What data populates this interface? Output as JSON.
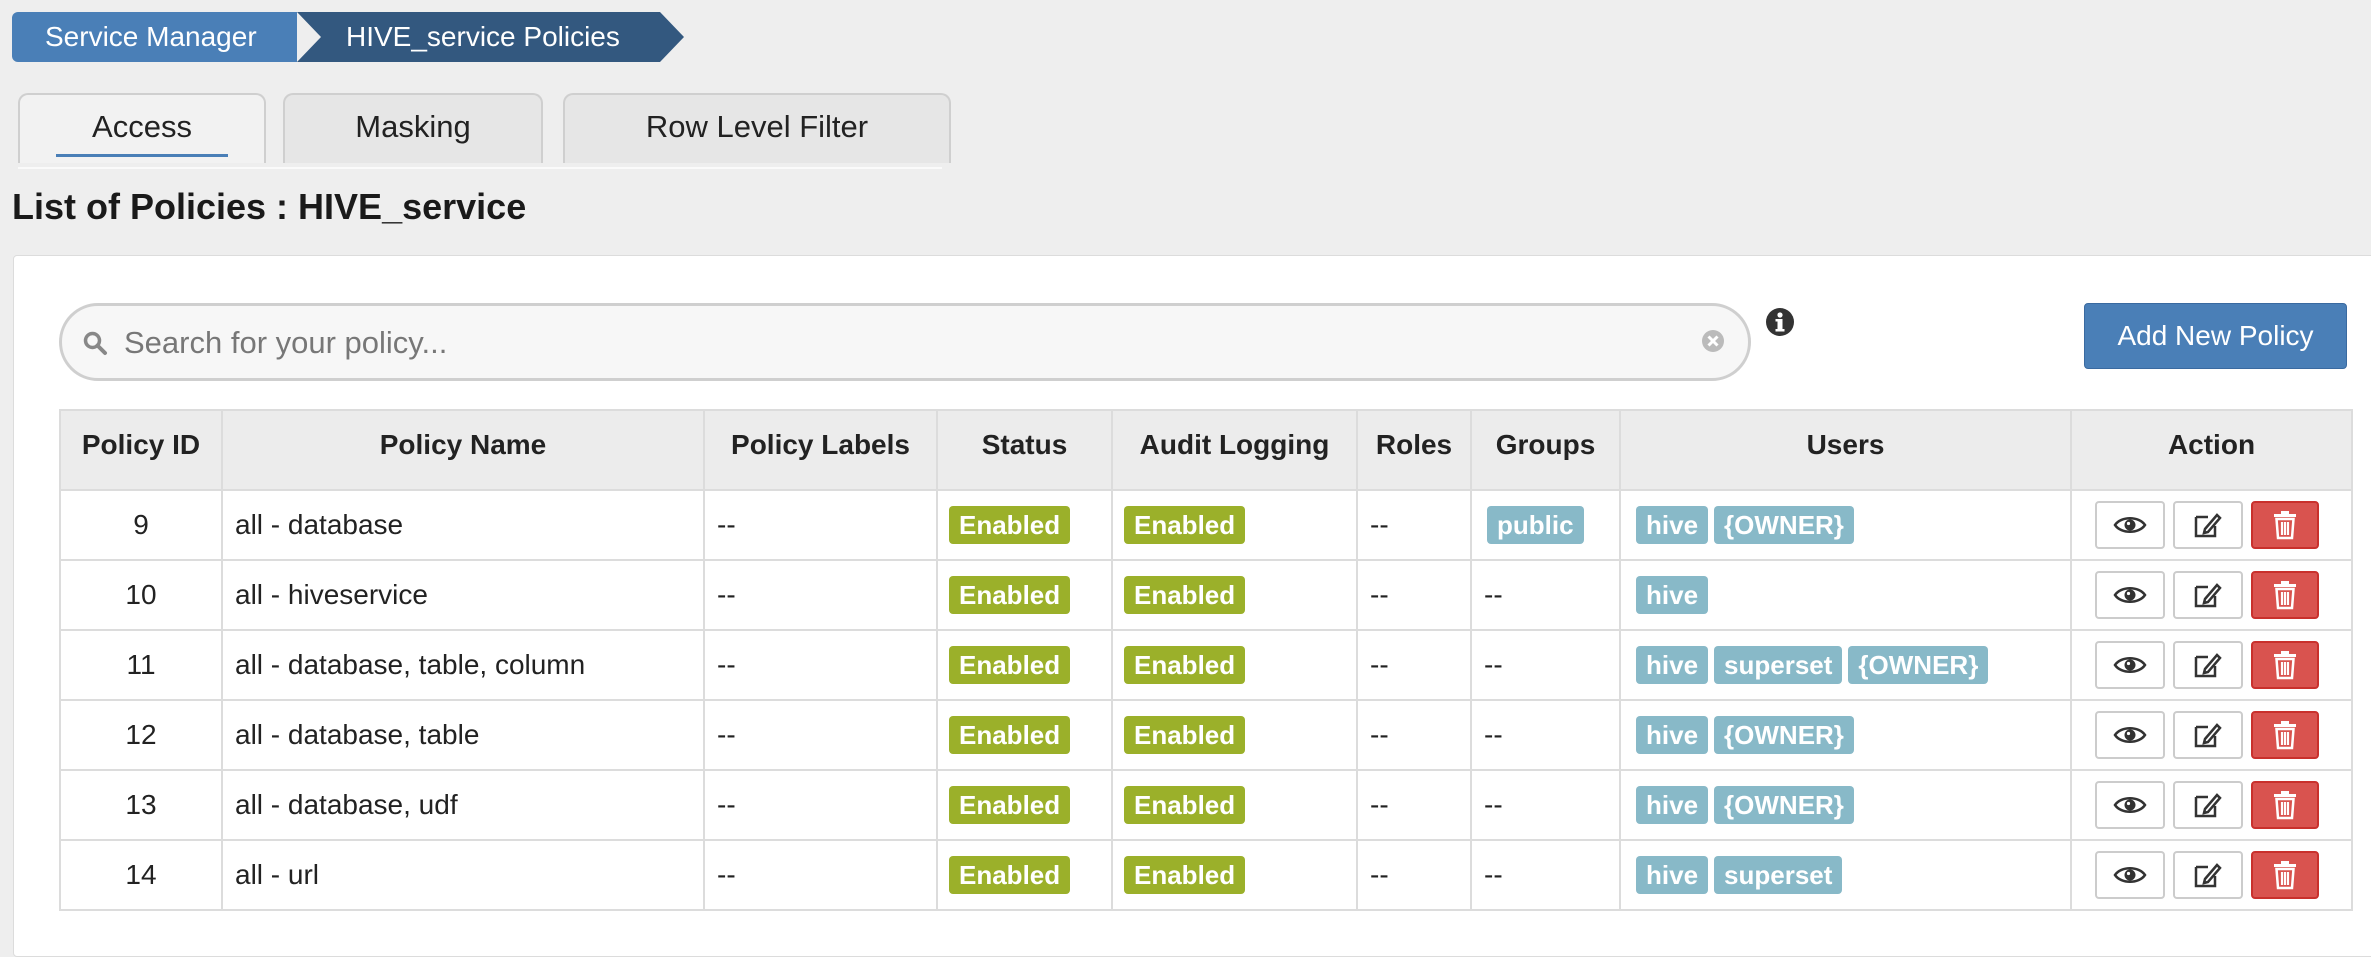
{
  "breadcrumb": {
    "items": [
      {
        "label": "Service Manager"
      },
      {
        "label": "HIVE_service Policies"
      }
    ]
  },
  "tabs": [
    {
      "label": "Access",
      "active": true
    },
    {
      "label": "Masking",
      "active": false
    },
    {
      "label": "Row Level Filter",
      "active": false
    }
  ],
  "page_title": "List of Policies : HIVE_service",
  "search": {
    "placeholder": "Search for your policy...",
    "value": ""
  },
  "add_button_label": "Add New Policy",
  "table": {
    "headers": [
      "Policy ID",
      "Policy Name",
      "Policy Labels",
      "Status",
      "Audit Logging",
      "Roles",
      "Groups",
      "Users",
      "Action"
    ],
    "rows": [
      {
        "id": "9",
        "name": "all - database",
        "labels": "--",
        "status": "Enabled",
        "audit": "Enabled",
        "roles": "--",
        "groups": [
          "public"
        ],
        "users": [
          "hive",
          "{OWNER}"
        ]
      },
      {
        "id": "10",
        "name": "all - hiveservice",
        "labels": "--",
        "status": "Enabled",
        "audit": "Enabled",
        "roles": "--",
        "groups": [],
        "users": [
          "hive"
        ]
      },
      {
        "id": "11",
        "name": "all - database, table, column",
        "labels": "--",
        "status": "Enabled",
        "audit": "Enabled",
        "roles": "--",
        "groups": [],
        "users": [
          "hive",
          "superset",
          "{OWNER}"
        ]
      },
      {
        "id": "12",
        "name": "all - database, table",
        "labels": "--",
        "status": "Enabled",
        "audit": "Enabled",
        "roles": "--",
        "groups": [],
        "users": [
          "hive",
          "{OWNER}"
        ]
      },
      {
        "id": "13",
        "name": "all - database, udf",
        "labels": "--",
        "status": "Enabled",
        "audit": "Enabled",
        "roles": "--",
        "groups": [],
        "users": [
          "hive",
          "{OWNER}"
        ]
      },
      {
        "id": "14",
        "name": "all - url",
        "labels": "--",
        "status": "Enabled",
        "audit": "Enabled",
        "roles": "--",
        "groups": [],
        "users": [
          "hive",
          "superset"
        ]
      }
    ],
    "empty_placeholder": "--"
  },
  "colors": {
    "primary": "#4a7fb7",
    "breadcrumb_dark": "#33587f",
    "enabled_badge": "#9bb02a",
    "user_badge": "#88b9c8",
    "delete": "#d9534f"
  },
  "icons": {
    "search": "search-icon",
    "clear": "clear-icon",
    "info": "info-icon",
    "view": "eye-icon",
    "edit": "edit-icon",
    "delete": "trash-icon"
  }
}
